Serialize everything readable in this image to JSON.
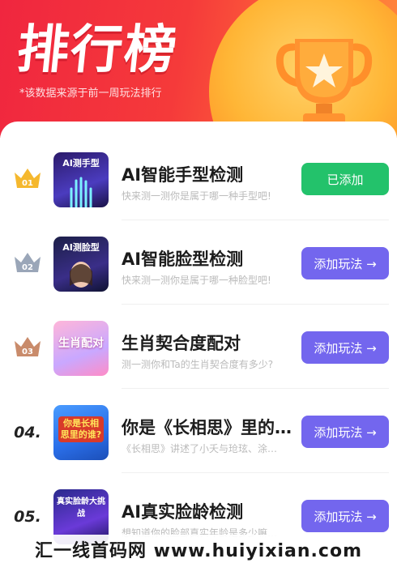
{
  "header": {
    "title": "排行榜",
    "subtitle": "*该数据来源于前一周玩法排行"
  },
  "colors": {
    "header_red": "#f0263f",
    "header_orange": "#ff8a3b",
    "added_green": "#23c26b",
    "add_purple": "#7366ee",
    "gold_crown": "#f5b82e",
    "silver_crown": "#9aa6b8",
    "bronze_crown": "#c98b6b"
  },
  "items": [
    {
      "rank": "01",
      "rank_style": "gold-crown-icon",
      "thumb_text": "AI测手型",
      "name": "AI智能手型检测",
      "desc": "快来测一测你是属于哪一种手型吧!",
      "button": "已添加",
      "button_state": "added"
    },
    {
      "rank": "02",
      "rank_style": "silver-crown-icon",
      "thumb_text": "AI测脸型",
      "name": "AI智能脸型检测",
      "desc": "快来测一测你是属于哪一种脸型吧!",
      "button": "添加玩法 →",
      "button_state": "add"
    },
    {
      "rank": "03",
      "rank_style": "bronze-crown-icon",
      "thumb_text": "生肖配对",
      "name": "生肖契合度配对",
      "desc": "测一测你和Ta的生肖契合度有多少?",
      "button": "添加玩法 →",
      "button_state": "add"
    },
    {
      "rank": "04.",
      "rank_style": "text",
      "thumb_text": "你是长相思里的谁?",
      "name": "你是《长相思》里的…",
      "desc": "《长相思》讲述了小夭与玱玹、涂…",
      "button": "添加玩法 →",
      "button_state": "add"
    },
    {
      "rank": "05.",
      "rank_style": "text",
      "thumb_text": "真实脸龄大挑战",
      "name": "AI真实脸龄检测",
      "desc": "想知道你的脸部真实年龄是多少嘛…",
      "button": "添加玩法 →",
      "button_state": "add"
    }
  ],
  "watermark": "汇一线首码网 www.huiyixian.com"
}
